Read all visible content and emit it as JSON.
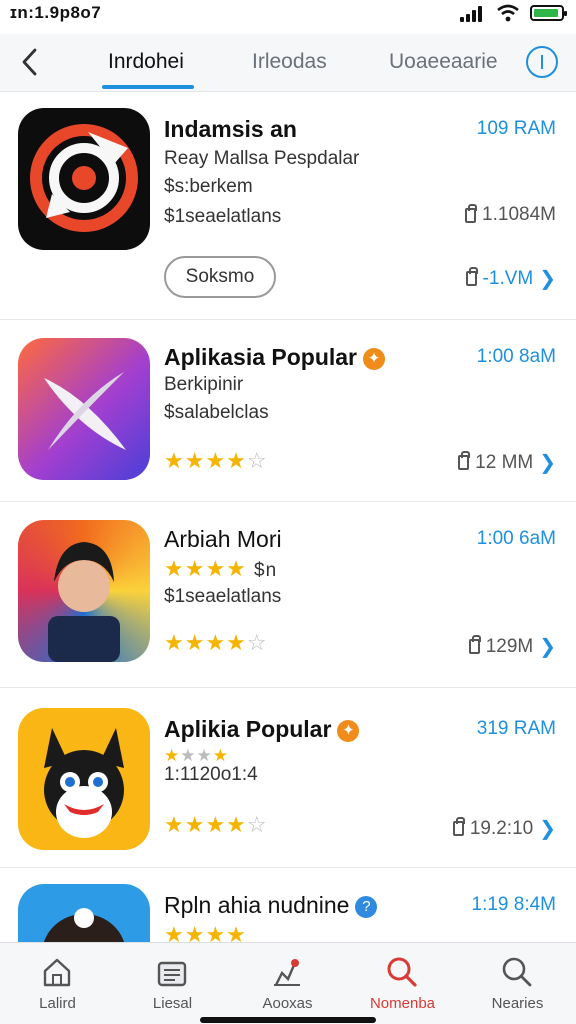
{
  "status_bar": {
    "time": "ɪn:1.9p8o7"
  },
  "header": {
    "tabs": [
      {
        "label": "Inrdohei",
        "active": true
      },
      {
        "label": "Irleodas",
        "active": false
      },
      {
        "label": "Uoaeeaarie",
        "active": false
      }
    ],
    "accent": "#1e90e0"
  },
  "apps": [
    {
      "title": "Indamsis an",
      "line1": "Reay Mallsa Pespdalar",
      "line2": "$s:berkem",
      "line3": "$1seaelatlans",
      "time": "109 RAM",
      "size1": "1.1084M",
      "button": "Soksmo",
      "size2": "-1.VM"
    },
    {
      "title": "Aplikasia Popular",
      "line1": "Berkipinir",
      "line2": "$salabelclas",
      "rating": 4,
      "time": "1:00 8aM",
      "size": "12 MM"
    },
    {
      "title": "Arbiah Mori",
      "line1": "$n",
      "line2": "$1seaelatlans",
      "rating": 4,
      "time": "1:00 6aM",
      "size": "129M"
    },
    {
      "title": "Aplikia Popular",
      "line1": "1:1120o1:4",
      "rating": 4,
      "time": "319 RAM",
      "size": "19.2:10"
    },
    {
      "title": "Rpln ahia nudnine",
      "time": "1:19 8:4M"
    }
  ],
  "bottom_nav": [
    {
      "label": "Lalird",
      "icon": "home-icon",
      "active": false
    },
    {
      "label": "Liesal",
      "icon": "stack-icon",
      "active": false
    },
    {
      "label": "Aooxas",
      "icon": "apps-icon",
      "active": false
    },
    {
      "label": "Nomenba",
      "icon": "search-icon",
      "active": true
    },
    {
      "label": "Nearies",
      "icon": "search-icon",
      "active": false
    }
  ]
}
